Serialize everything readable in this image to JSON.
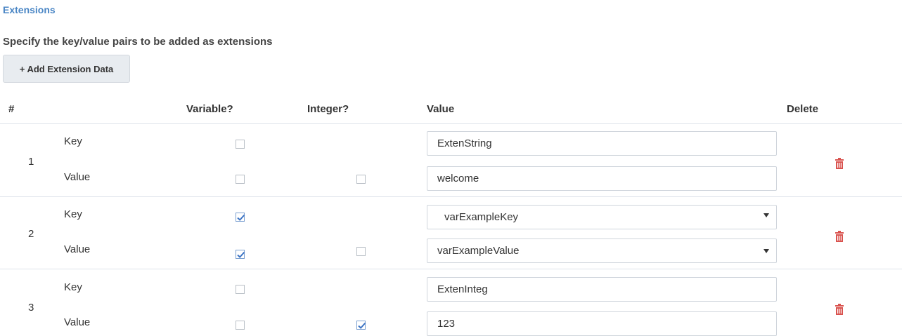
{
  "section_title": "Extensions",
  "instructions": "Specify the key/value pairs to be added as extensions",
  "add_button_label": "+ Add Extension Data",
  "columns": {
    "index": "#",
    "variable": "Variable?",
    "integer": "Integer?",
    "value": "Value",
    "delete": "Delete"
  },
  "rows": [
    {
      "index": "1",
      "key_label": "Key",
      "value_label": "Value",
      "key_variable": false,
      "value_variable": false,
      "value_integer": false,
      "key_value": "ExtenString",
      "value_value": "welcome"
    },
    {
      "index": "2",
      "key_label": "Key",
      "value_label": "Value",
      "key_variable": true,
      "value_variable": true,
      "value_integer": false,
      "key_value": "varExampleKey",
      "value_value": "varExampleValue"
    },
    {
      "index": "3",
      "key_label": "Key",
      "value_label": "Value",
      "key_variable": false,
      "value_variable": false,
      "value_integer": true,
      "key_value": "ExtenInteg",
      "value_value": "123"
    }
  ],
  "colors": {
    "accent": "#4a86c5",
    "check": "#3b73c4",
    "delete": "#d9534f",
    "divider": "#dde3ea"
  }
}
